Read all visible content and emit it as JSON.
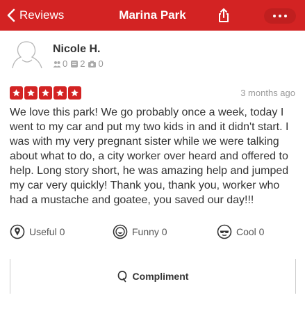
{
  "header": {
    "back_label": "Reviews",
    "title": "Marina Park",
    "accent_color": "#d32323"
  },
  "reviewer": {
    "name": "Nicole H.",
    "friends": "0",
    "reviews": "2",
    "photos": "0"
  },
  "review": {
    "rating": 5,
    "max_rating": 5,
    "date": "3 months ago",
    "text": "We love this park! We go probably once a week, today I went to my car and put my two kids in and it didn't start. I was with my very pregnant sister while we were talking about what to do, a city worker over heard and offered to help. Long story short, he was amazing help and jumped my car very quickly! Thank you, thank you, worker who had a mustache and goatee, you saved our day!!!"
  },
  "actions": {
    "useful": "Useful 0",
    "funny": "Funny 0",
    "cool": "Cool 0"
  },
  "compliment": {
    "label": "Compliment"
  },
  "icons": [
    "chevron-left-icon",
    "share-icon",
    "more-icon",
    "avatar-placeholder-icon",
    "friends-icon",
    "reviews-icon",
    "photos-icon",
    "star-icon",
    "useful-icon",
    "funny-icon",
    "cool-icon",
    "compliment-icon"
  ]
}
